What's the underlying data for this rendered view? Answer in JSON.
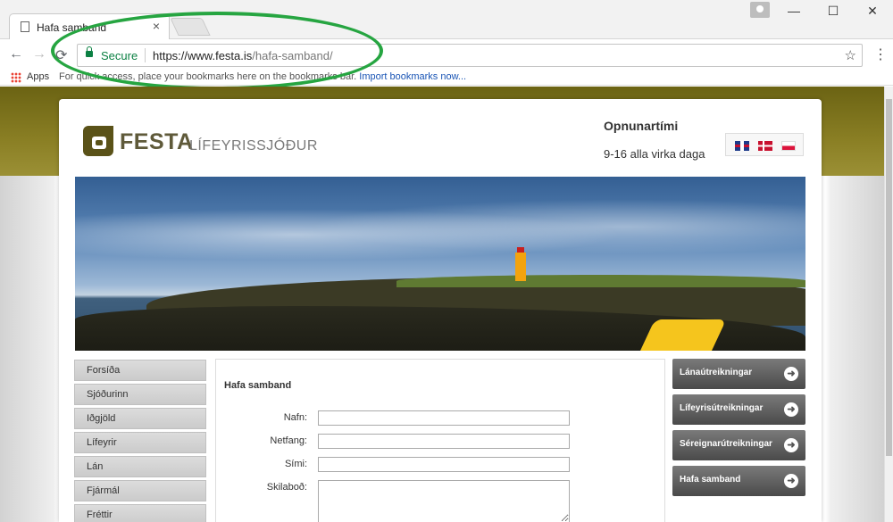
{
  "browser": {
    "tab_title": "Hafa samband",
    "tab_close": "×",
    "secure_label": "Secure",
    "url_host": "https://www.festa.is",
    "url_path": "/hafa-samband/",
    "apps_label": "Apps",
    "bookmarks_hint": "For quick access, place your bookmarks here on the bookmarks bar.",
    "import_link": "Import bookmarks now...",
    "icons": {
      "back": "←",
      "forward": "→",
      "reload": "⟳",
      "star": "☆",
      "menu": "⋮",
      "minimize": "—",
      "maximize": "☐",
      "close": "✕"
    }
  },
  "header": {
    "brand": "FESTA",
    "brand_sub": "LÍFEYRISSJÓÐUR",
    "hours_title": "Opnunartími",
    "hours_text": "9-16 alla virka daga"
  },
  "left_nav": [
    "Forsíða",
    "Sjóðurinn",
    "Iðgjöld",
    "Lífeyrir",
    "Lán",
    "Fjármál",
    "Fréttir"
  ],
  "form": {
    "title": "Hafa samband",
    "fields": [
      {
        "label": "Nafn:",
        "value": ""
      },
      {
        "label": "Netfang:",
        "value": ""
      },
      {
        "label": "Sími:",
        "value": ""
      }
    ],
    "message_label": "Skilaboð:"
  },
  "right_nav": [
    {
      "label": "Lánaútreikningar",
      "arrow": "➜"
    },
    {
      "label": "Lífeyrisútreikningar",
      "arrow": "➜"
    },
    {
      "label": "Séreignarútreikningar",
      "arrow": "➜"
    },
    {
      "label": "Hafa samband",
      "arrow": "➜"
    }
  ],
  "colors": {
    "olive_band": "#8a7f24",
    "secure_green": "#0b8043",
    "annotation_green": "#26a541",
    "logo_brown": "#5a5218"
  }
}
